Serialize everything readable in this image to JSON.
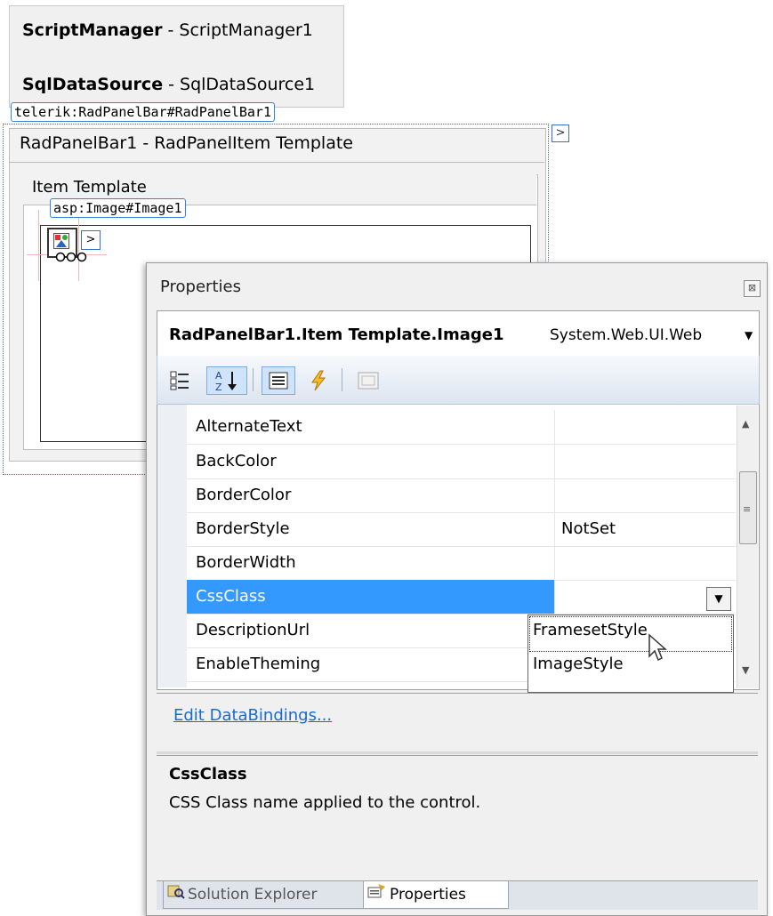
{
  "designer": {
    "script_manager": {
      "type": "ScriptManager",
      "name": " - ScriptManager1"
    },
    "sql_data_source": {
      "type": "SqlDataSource",
      "name": " - SqlDataSource1"
    },
    "panelbar_tag": "telerik:RadPanelBar#RadPanelBar1",
    "panel_title": "RadPanelBar1 - RadPanelItem Template",
    "smart_tag_glyph": ">",
    "item_template_title": "Item Template",
    "image_tag": "asp:Image#Image1"
  },
  "properties": {
    "title": "Properties",
    "close_glyph": "⊠",
    "selected_object": "RadPanelBar1.Item Template.Image1",
    "selected_type": "System.Web.UI.Web",
    "rows": [
      {
        "name": "AlternateText",
        "value": ""
      },
      {
        "name": "BackColor",
        "value": ""
      },
      {
        "name": "BorderColor",
        "value": ""
      },
      {
        "name": "BorderStyle",
        "value": "NotSet"
      },
      {
        "name": "BorderWidth",
        "value": ""
      },
      {
        "name": "CssClass",
        "value": ""
      },
      {
        "name": "DescriptionUrl",
        "value": ""
      },
      {
        "name": "EnableTheming",
        "value": ""
      }
    ],
    "dropdown_options": [
      "FramesetStyle",
      "ImageStyle"
    ],
    "edit_databindings": "Edit DataBindings...",
    "description_title": "CssClass",
    "description_text": "CSS Class name applied to the control.",
    "tabs": [
      "Solution Explorer",
      "Properties"
    ]
  },
  "colors": {
    "selection": "#3399ff",
    "link": "#1a6bcc",
    "smart_tag_border": "#3b6fc7"
  }
}
